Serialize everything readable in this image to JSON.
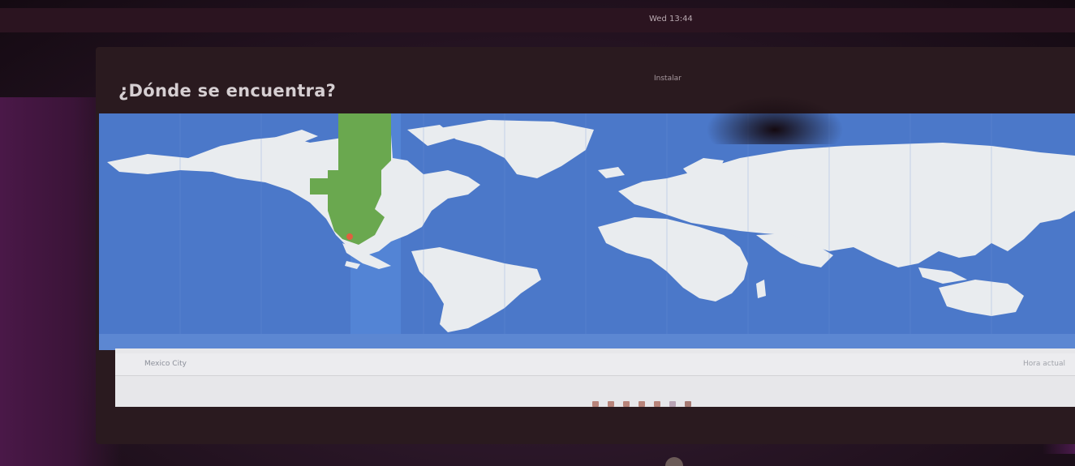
{
  "top_panel": {
    "text": "Wed 13:44"
  },
  "window": {
    "title": "Instalar"
  },
  "page": {
    "question": "¿Dónde se encuentra?"
  },
  "timezone_map": {
    "highlight_color": "#6aa84f",
    "ocean_color": "#4b78c9",
    "land_color": "#e9ecef",
    "selected_zone_color": "#5688d8",
    "marker_color": "#e06040"
  },
  "location": {
    "value": "Mexico City",
    "timezone_label": "Hora actual"
  },
  "progress": {
    "total_steps": 7,
    "current_step": 6
  }
}
